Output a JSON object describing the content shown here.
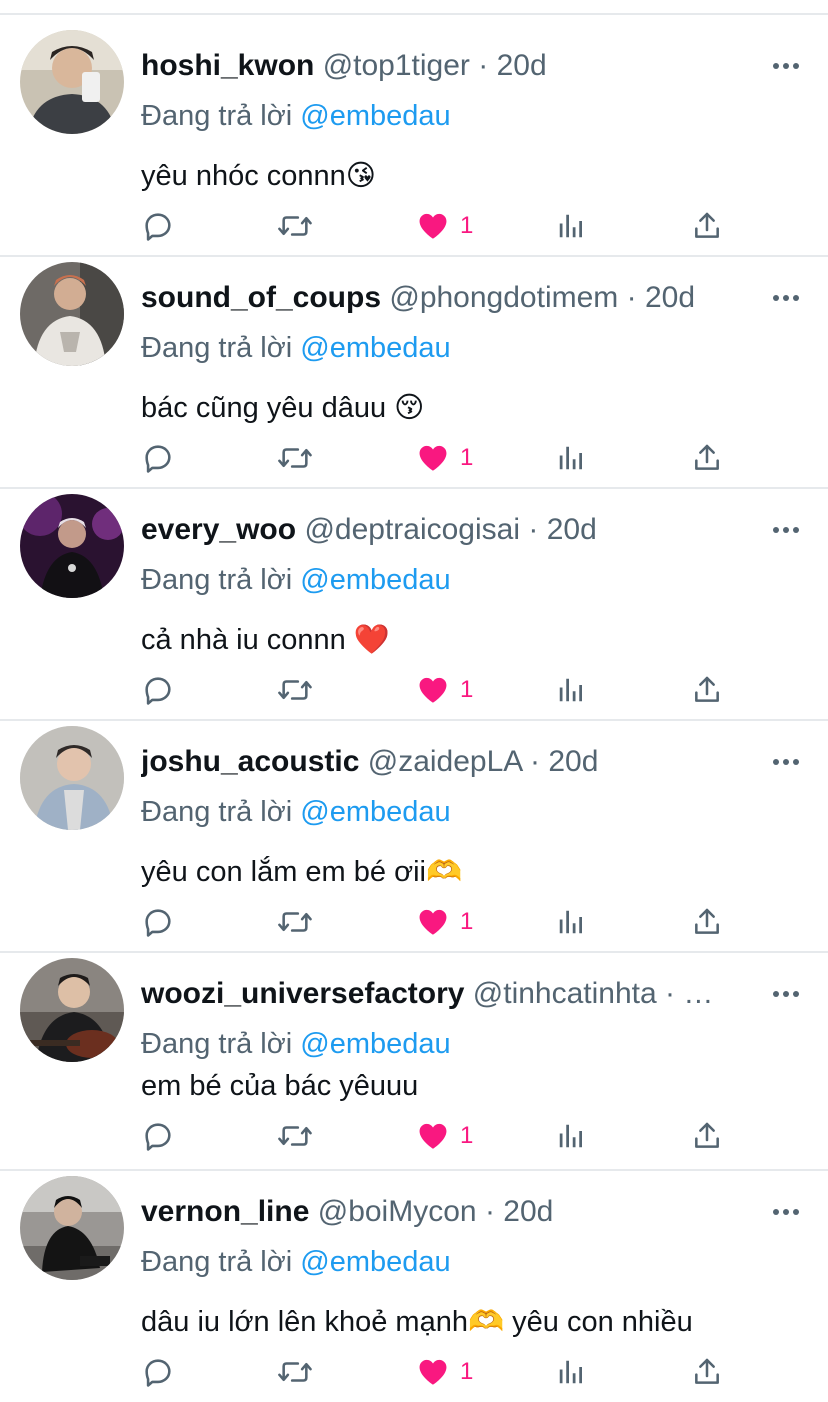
{
  "accent_colors": {
    "mention": "#1d9bf0",
    "like": "#f91880",
    "secondary_text": "#536471",
    "primary_text": "#0f1419",
    "divider": "#e6e9ec"
  },
  "icons": [
    "reply-icon",
    "retweet-icon",
    "heart-icon",
    "analytics-icon",
    "share-icon",
    "more-icon"
  ],
  "replies": [
    {
      "display_name": "hoshi_kwon",
      "handle": "@top1tiger",
      "separator": "·",
      "time": "20d",
      "reply_prefix": "Đang trả lời",
      "reply_to": "@embedau",
      "text": "yêu nhóc connn😘",
      "like_count": "1"
    },
    {
      "display_name": "sound_of_coups",
      "handle": "@phongdotimem",
      "separator": "·",
      "time": "20d",
      "reply_prefix": "Đang trả lời",
      "reply_to": "@embedau",
      "text": "bác cũng yêu dâuu 😚",
      "like_count": "1"
    },
    {
      "display_name": "every_woo",
      "handle": "@deptraicogisai",
      "separator": "·",
      "time": "20d",
      "reply_prefix": "Đang trả lời",
      "reply_to": "@embedau",
      "text": "cả nhà iu connn ❤️",
      "like_count": "1"
    },
    {
      "display_name": "joshu_acoustic",
      "handle": "@zaidepLA",
      "separator": "·",
      "time": "20d",
      "reply_prefix": "Đang trả lời",
      "reply_to": "@embedau",
      "text": "yêu con lắm em bé ơii🫶",
      "like_count": "1"
    },
    {
      "display_name": "woozi_universefactory",
      "handle": "@tinhcatinhta",
      "separator": "·",
      "time": "…",
      "reply_prefix": "Đang trả lời",
      "reply_to": "@embedau",
      "text": "em bé của bác yêuuu",
      "like_count": "1"
    },
    {
      "display_name": "vernon_line",
      "handle": "@boiMycon",
      "separator": "·",
      "time": "20d",
      "reply_prefix": "Đang trả lời",
      "reply_to": "@embedau",
      "text": "dâu iu lớn lên khoẻ mạnh🫶 yêu con nhiều",
      "like_count": "1"
    }
  ]
}
